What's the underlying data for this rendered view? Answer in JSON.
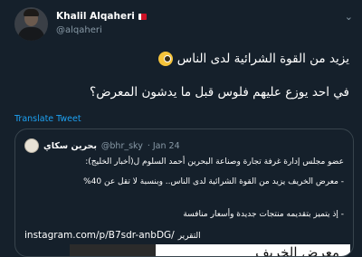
{
  "tweet": {
    "author_name": "Khalil Alqaheri",
    "author_handle": "@alqaheri",
    "line1": "يزيد من القوة الشرائية لدى الناس",
    "line2": "في احد يوزع عليهم فلوس قبل ما يدشون المعرض؟",
    "translate_label": "Translate Tweet",
    "icons": [
      "avatar",
      "bahrain-flag-icon",
      "chevron-down-icon",
      "monocle-face-emoji"
    ]
  },
  "quoted": {
    "author_name": "بحرين سكاي",
    "author_handle": "@bhr_sky",
    "date": "· Jan 24",
    "paragraph1": "عضو مجلس إدارة غرفة تجارة وصناعة البحرين أحمد السلوم ل(أخبار الخليج):",
    "paragraph2": "- معرض الخريف يزيد من القوة الشرائية لدى الناس.. وبنسبة لا تقل عن 40%",
    "paragraph3": "- إذ يتميز بتقديمه منتجات جديدة وأسعار منافسة",
    "link": "instagram.com/p/B7sdr-anbDG/",
    "link_prefix": "التقرير",
    "image_text": "معرض الخريف"
  },
  "colors": {
    "background": "#15202b",
    "secondary_text": "#8899a6",
    "link": "#1da1f2",
    "border": "#38444d"
  }
}
